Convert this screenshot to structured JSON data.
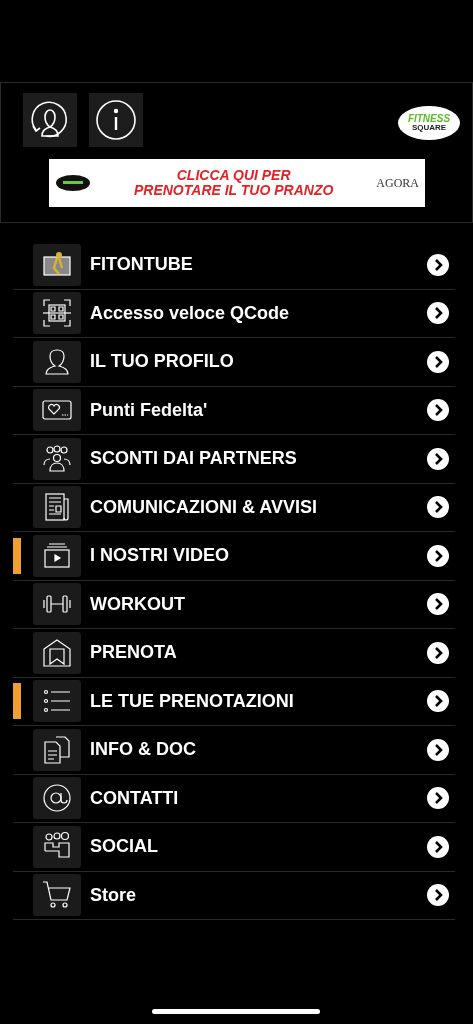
{
  "header": {
    "logo": {
      "line1": "FITNESS",
      "line2": "SQUARE"
    },
    "banner": {
      "line1": "CLICCA QUI PER",
      "line2": "PRENOTARE IL TUO PRANZO",
      "partner": "AGORA"
    }
  },
  "menu": [
    {
      "label": "FITONTUBE",
      "kind": "video-player",
      "flagged": false
    },
    {
      "label": "Accesso veloce QCode",
      "kind": "qr",
      "flagged": false
    },
    {
      "label": "IL TUO PROFILO",
      "kind": "person",
      "flagged": false
    },
    {
      "label": "Punti Fedelta'",
      "kind": "card",
      "flagged": false
    },
    {
      "label": "SCONTI DAI PARTNERS",
      "kind": "group",
      "flagged": false
    },
    {
      "label": "COMUNICAZIONI & AVVISI",
      "kind": "news",
      "flagged": false
    },
    {
      "label": "I NOSTRI VIDEO",
      "kind": "play",
      "flagged": true
    },
    {
      "label": "WORKOUT",
      "kind": "dumbbell",
      "flagged": false
    },
    {
      "label": "PRENOTA",
      "kind": "bookmark",
      "flagged": false
    },
    {
      "label": "LE TUE PRENOTAZIONI",
      "kind": "list",
      "flagged": true
    },
    {
      "label": "INFO & DOC",
      "kind": "docs",
      "flagged": false
    },
    {
      "label": "CONTATTI",
      "kind": "at",
      "flagged": false
    },
    {
      "label": "SOCIAL",
      "kind": "people",
      "flagged": false
    },
    {
      "label": "Store",
      "kind": "cart",
      "flagged": false
    }
  ]
}
